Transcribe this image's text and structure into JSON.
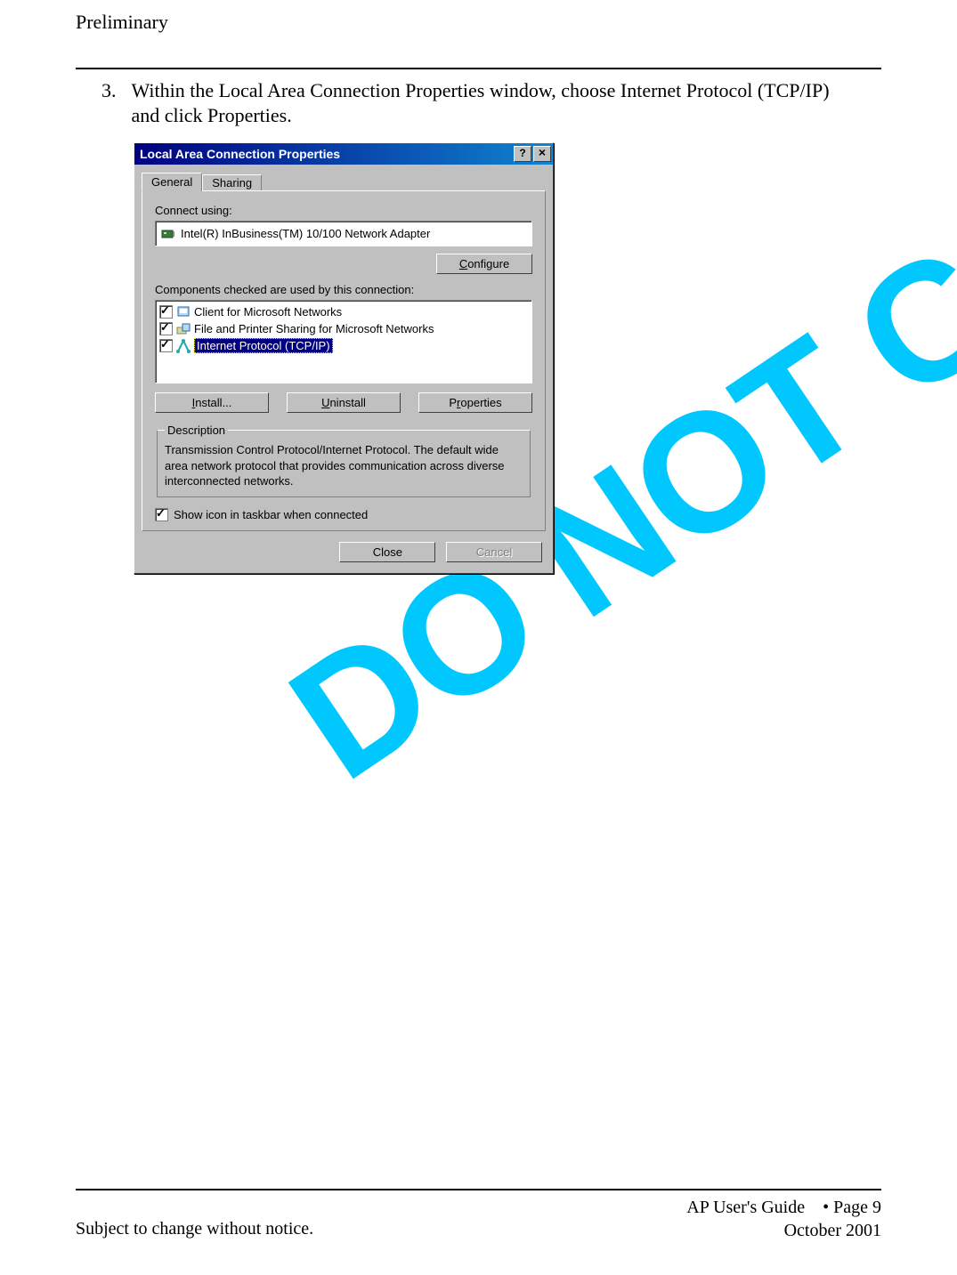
{
  "header": {
    "status": "Preliminary"
  },
  "step": {
    "number": "3.",
    "text": "Within the Local Area Connection Properties window, choose Internet Protocol (TCP/IP) and click Properties."
  },
  "watermark": "DO NOT COPY",
  "dialog": {
    "title": "Local Area Connection Properties",
    "tabs": {
      "general": "General",
      "sharing": "Sharing"
    },
    "connect_using_label": "Connect using:",
    "adapter": "Intel(R) InBusiness(TM) 10/100 Network Adapter",
    "configure_btn": "Configure",
    "components_label": "Components checked are used by this connection:",
    "components": [
      {
        "checked": true,
        "label": "Client for Microsoft Networks",
        "selected": false,
        "icon": "client"
      },
      {
        "checked": true,
        "label": "File and Printer Sharing for Microsoft Networks",
        "selected": false,
        "icon": "service"
      },
      {
        "checked": true,
        "label": "Internet Protocol (TCP/IP)",
        "selected": true,
        "icon": "protocol"
      }
    ],
    "buttons": {
      "install": "Install...",
      "uninstall": "Uninstall",
      "properties": "Properties"
    },
    "description_legend": "Description",
    "description_text": "Transmission Control Protocol/Internet Protocol. The default wide area network protocol that provides communication across diverse interconnected networks.",
    "show_icon_label": "Show icon in taskbar when connected",
    "show_icon_checked": true,
    "close_btn": "Close",
    "cancel_btn": "Cancel"
  },
  "footer": {
    "guide": "AP User's Guide",
    "page": "• Page 9",
    "date": "October 2001",
    "notice": "Subject to change without notice."
  }
}
